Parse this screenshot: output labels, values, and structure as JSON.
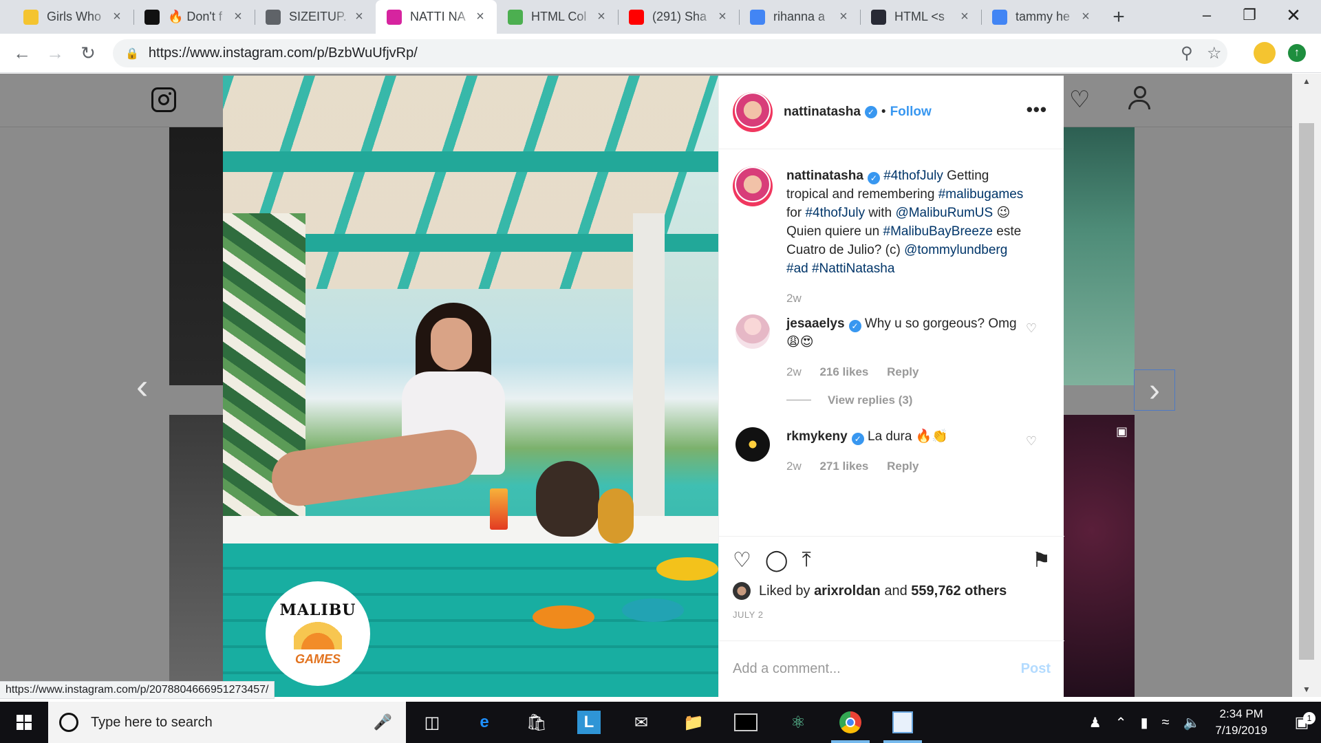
{
  "browser": {
    "tabs": [
      {
        "title": "Girls Who",
        "favicon": "lightbulb-icon",
        "color": "#f4c430"
      },
      {
        "title": "🔥 Don't f",
        "favicon": "nova-icon",
        "color": "#111111"
      },
      {
        "title": "SIZEITUP.",
        "favicon": "globe-icon",
        "color": "#5f6368"
      },
      {
        "title": "NATTI NA",
        "favicon": "instagram-icon",
        "color": "#d6249f"
      },
      {
        "title": "HTML Col",
        "favicon": "w3schools-icon",
        "color": "#4caf50"
      },
      {
        "title": "(291) Sha",
        "favicon": "youtube-icon",
        "color": "#ff0000"
      },
      {
        "title": "rihanna a",
        "favicon": "google-icon",
        "color": "#4285f4"
      },
      {
        "title": "HTML <s",
        "favicon": "w3-icon",
        "color": "#282a35"
      },
      {
        "title": "tammy he",
        "favicon": "google-icon",
        "color": "#4285f4"
      }
    ],
    "active_tab_index": 3,
    "new_tab_label": "+",
    "url": "https://www.instagram.com/p/BzbWuUfjvRp/",
    "status_url": "https://www.instagram.com/p/2078804666951273457/"
  },
  "post": {
    "username": "nattinatasha",
    "follow_label": "Follow",
    "caption": {
      "username": "nattinatasha",
      "parts": [
        {
          "text": "#4thofJuly",
          "tag": true
        },
        {
          "text": " Getting tropical and remembering ",
          "tag": false
        },
        {
          "text": "#malibugames",
          "tag": true
        },
        {
          "text": " for ",
          "tag": false
        },
        {
          "text": "#4thofJuly",
          "tag": true
        },
        {
          "text": " with ",
          "tag": false
        },
        {
          "text": "@MalibuRumUS",
          "tag": true
        },
        {
          "text": " 😉 Quien quiere un ",
          "tag": false
        },
        {
          "text": "#MalibuBayBreeze",
          "tag": true
        },
        {
          "text": " este Cuatro de Julio? (c) ",
          "tag": false
        },
        {
          "text": "@tommylundberg",
          "tag": true
        },
        {
          "text": " ",
          "tag": false
        },
        {
          "text": "#ad",
          "tag": true
        },
        {
          "text": " ",
          "tag": false
        },
        {
          "text": "#NattiNatasha",
          "tag": true
        }
      ],
      "age": "2w"
    },
    "comments": [
      {
        "username": "jesaaelys",
        "text": "Why u so gorgeous? Omg 😩😍",
        "age": "2w",
        "likes": "216 likes",
        "reply": "Reply",
        "view_replies": "View replies (3)"
      },
      {
        "username": "rkmykeny",
        "text": "La dura 🔥👏",
        "age": "2w",
        "likes": "271 likes",
        "reply": "Reply"
      }
    ],
    "liked_by_prefix": "Liked by",
    "liked_by_user": "arixroldan",
    "liked_by_and": "and",
    "liked_by_count": "559,762 others",
    "date": "JULY 2",
    "add_comment_placeholder": "Add a comment...",
    "post_label": "Post",
    "photo_badge": {
      "brand": "MALIBU",
      "sub": "GAMES"
    }
  },
  "taskbar": {
    "search_placeholder": "Type here to search",
    "apps": [
      "task-view-icon",
      "edge-icon",
      "store-icon",
      "l-app-icon",
      "mail-icon",
      "file-explorer-icon",
      "terminal-icon",
      "atom-icon",
      "chrome-icon",
      "paint-icon"
    ],
    "time": "2:34 PM",
    "date": "7/19/2019",
    "notification_count": "1"
  }
}
